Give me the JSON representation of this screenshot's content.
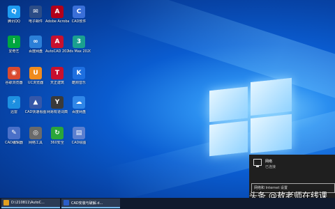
{
  "desktop": {
    "icons": [
      {
        "label": "腾讯QQ",
        "glyph": "Q",
        "color": "#1e9bf0"
      },
      {
        "label": "电子邮件",
        "glyph": "✉",
        "color": "#2b4c86"
      },
      {
        "label": "Adobe Acrobat DC",
        "glyph": "A",
        "color": "#b3001b"
      },
      {
        "label": "CAD软件",
        "glyph": "C",
        "color": "#3a6fd8"
      },
      {
        "label": "爱奇艺",
        "glyph": "i",
        "color": "#00a63f"
      },
      {
        "label": "百度网盘",
        "glyph": "∞",
        "color": "#2b7fd8"
      },
      {
        "label": "AutoCAD 2020",
        "glyph": "A",
        "color": "#c8102e"
      },
      {
        "label": "3ds Max 2020",
        "glyph": "3",
        "color": "#1aa090"
      },
      {
        "label": "谷歌浏览器",
        "glyph": "◉",
        "color": "#d94a30"
      },
      {
        "label": "UC浏览器",
        "glyph": "U",
        "color": "#f08b1d"
      },
      {
        "label": "天正建筑",
        "glyph": "T",
        "color": "#c8102e"
      },
      {
        "label": "酷狗音乐",
        "glyph": "K",
        "color": "#1e6fe0"
      },
      {
        "label": "迅雷",
        "glyph": "⚡",
        "color": "#1d8fe0"
      },
      {
        "label": "CAD快速看图",
        "glyph": "▲",
        "color": "#3557a8"
      },
      {
        "label": "网易有道词典",
        "glyph": "Y",
        "color": "#3a3a3a"
      },
      {
        "label": "百度网盘",
        "glyph": "☁",
        "color": "#2f86e8"
      },
      {
        "label": "CAD编辑器",
        "glyph": "✎",
        "color": "#4a70c8"
      },
      {
        "label": "网络工具",
        "glyph": "◎",
        "color": "#6a6a6a"
      },
      {
        "label": "360安全",
        "glyph": "↻",
        "color": "#2aa63a"
      },
      {
        "label": "CAD绘图",
        "glyph": "▤",
        "color": "#5a7fd0"
      }
    ]
  },
  "flyout": {
    "network_name": "网络",
    "network_status": "已连接",
    "settings_link": "网络和 Internet 设置"
  },
  "watermark": {
    "text": "头条 @敖老师在线课"
  },
  "taskbar": {
    "apps": [
      {
        "label": "D:\\210811\\AutoC...",
        "color": "#e0a020"
      },
      {
        "label": "CAD安装与破解.d...",
        "color": "#2b5ec8"
      }
    ]
  }
}
